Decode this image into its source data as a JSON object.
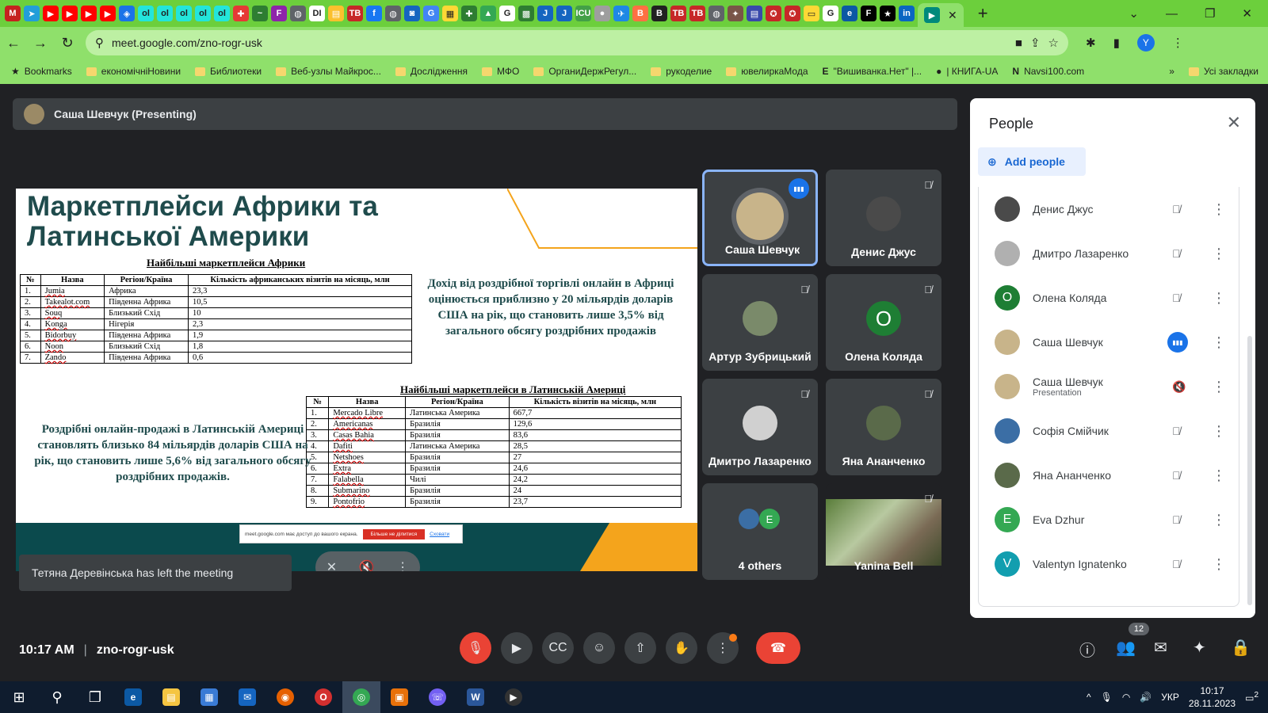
{
  "browser": {
    "favicons": [
      {
        "name": "gmail-icon",
        "color": "#c5221f",
        "glyph": "M"
      },
      {
        "name": "telegram-icon",
        "color": "#229ed9",
        "glyph": "➤"
      },
      {
        "name": "youtube-icon",
        "color": "#ff0000",
        "glyph": "▶"
      },
      {
        "name": "youtube-icon",
        "color": "#ff0000",
        "glyph": "▶"
      },
      {
        "name": "youtube-icon",
        "color": "#ff0000",
        "glyph": "▶"
      },
      {
        "name": "youtube-icon",
        "color": "#ff0000",
        "glyph": "▶"
      },
      {
        "name": "generic-site-icon",
        "color": "#1a73e8",
        "glyph": "◈"
      },
      {
        "name": "olx-icon",
        "color": "#23e5db",
        "glyph": "ol"
      },
      {
        "name": "olx-icon",
        "color": "#23e5db",
        "glyph": "ol"
      },
      {
        "name": "olx-icon",
        "color": "#23e5db",
        "glyph": "ol"
      },
      {
        "name": "olx-icon",
        "color": "#23e5db",
        "glyph": "ol"
      },
      {
        "name": "olx-icon",
        "color": "#23e5db",
        "glyph": "ol"
      },
      {
        "name": "generic-site-icon",
        "color": "#e53935",
        "glyph": "✚"
      },
      {
        "name": "generic-site-icon",
        "color": "#2e7d32",
        "glyph": "~"
      },
      {
        "name": "generic-site-icon",
        "color": "#8e24aa",
        "glyph": "F"
      },
      {
        "name": "generic-site-icon",
        "color": "#5f6368",
        "glyph": "◍"
      },
      {
        "name": "generic-site-icon",
        "color": "#ffffff",
        "glyph": "DI"
      },
      {
        "name": "generic-site-icon",
        "color": "#fbc02d",
        "glyph": "▤"
      },
      {
        "name": "tv-icon",
        "color": "#c62828",
        "glyph": "TB"
      },
      {
        "name": "facebook-icon",
        "color": "#1877f2",
        "glyph": "f"
      },
      {
        "name": "generic-site-icon",
        "color": "#5f6368",
        "glyph": "◍"
      },
      {
        "name": "generic-site-icon",
        "color": "#1565c0",
        "glyph": "◙"
      },
      {
        "name": "translate-icon",
        "color": "#4285f4",
        "glyph": "G"
      },
      {
        "name": "generic-site-icon",
        "color": "#fdd835",
        "glyph": "▦"
      },
      {
        "name": "generic-site-icon",
        "color": "#2e7d32",
        "glyph": "✚"
      },
      {
        "name": "drive-icon",
        "color": "#34a853",
        "glyph": "▲"
      },
      {
        "name": "google-icon",
        "color": "#ffffff",
        "glyph": "G"
      },
      {
        "name": "generic-site-icon",
        "color": "#2e7d32",
        "glyph": "▩"
      },
      {
        "name": "generic-site-icon",
        "color": "#1565c0",
        "glyph": "J"
      },
      {
        "name": "generic-site-icon",
        "color": "#1565c0",
        "glyph": "J"
      },
      {
        "name": "generic-site-icon",
        "color": "#43a047",
        "glyph": "ICU"
      },
      {
        "name": "generic-site-icon",
        "color": "#9e9e9e",
        "glyph": "●"
      },
      {
        "name": "generic-site-icon",
        "color": "#1e88e5",
        "glyph": "✈"
      },
      {
        "name": "generic-site-icon",
        "color": "#ff7043",
        "glyph": "B"
      },
      {
        "name": "generic-site-icon",
        "color": "#212121",
        "glyph": "B"
      },
      {
        "name": "tv-icon",
        "color": "#c62828",
        "glyph": "TB"
      },
      {
        "name": "tv-icon",
        "color": "#c62828",
        "glyph": "TB"
      },
      {
        "name": "generic-site-icon",
        "color": "#5f6368",
        "glyph": "◍"
      },
      {
        "name": "generic-site-icon",
        "color": "#795548",
        "glyph": "✦"
      },
      {
        "name": "generic-site-icon",
        "color": "#3949ab",
        "glyph": "▤"
      },
      {
        "name": "generic-site-icon",
        "color": "#c62828",
        "glyph": "✪"
      },
      {
        "name": "generic-site-icon",
        "color": "#c62828",
        "glyph": "✪"
      },
      {
        "name": "generic-site-icon",
        "color": "#fdd835",
        "glyph": "▭"
      },
      {
        "name": "google-icon",
        "color": "#ffffff",
        "glyph": "G"
      },
      {
        "name": "edge-icon",
        "color": "#0c59a4",
        "glyph": "e"
      },
      {
        "name": "generic-site-icon",
        "color": "#000000",
        "glyph": "F"
      },
      {
        "name": "generic-site-icon",
        "color": "#000000",
        "glyph": "★"
      },
      {
        "name": "linkedin-icon",
        "color": "#0a66c2",
        "glyph": "in"
      }
    ],
    "active_tab_icon": "meet-icon",
    "close_glyph": "✕",
    "new_tab_glyph": "+",
    "win_controls": [
      "⌄",
      "—",
      "❐",
      "✕"
    ],
    "url": "meet.google.com/zno-rogr-usk",
    "profile_initial": "Y",
    "bookmarks": [
      {
        "label": "Bookmarks",
        "icon": "star"
      },
      {
        "label": "економічніНовини",
        "icon": "folder"
      },
      {
        "label": "Библиотеки",
        "icon": "folder"
      },
      {
        "label": "Веб-узлы Майкрос...",
        "icon": "folder"
      },
      {
        "label": "Дослідження",
        "icon": "folder"
      },
      {
        "label": "МФО",
        "icon": "folder"
      },
      {
        "label": "ОрганиДержРегул...",
        "icon": "folder"
      },
      {
        "label": "рукоделие",
        "icon": "folder"
      },
      {
        "label": "ювелиркаМода",
        "icon": "folder"
      },
      {
        "label": "\"Вишиванка.Нет\" |...",
        "icon": "E"
      },
      {
        "label": "| КНИГА-UA",
        "icon": "dot"
      },
      {
        "label": "Navsi100.com",
        "icon": "N"
      }
    ],
    "bookmarks_more": "»",
    "all_bookmarks": "Усі закладки"
  },
  "meet": {
    "presenter_label": "Саша Шевчук (Presenting)",
    "meeting_code": "zno-rogr-usk",
    "time": "10:17 AM",
    "toast": "Тетяна Деревінська has left the meeting",
    "participants_count": "12",
    "slide": {
      "title": "Маркетплейси Африки та Латинської Америки",
      "table1_caption": "Найбільші маркетплейси Африки",
      "table1_headers": [
        "№",
        "Назва",
        "Регіон/Країна",
        "Кількість африканських візитів на місяць, млн"
      ],
      "table1_rows": [
        [
          "1.",
          "Jumia",
          "Африка",
          "23,3"
        ],
        [
          "2.",
          "Takealot.com",
          "Південна Африка",
          "10,5"
        ],
        [
          "3.",
          "Souq",
          "Близький Схід",
          "10"
        ],
        [
          "4.",
          "Konga",
          "Нігерія",
          "2,3"
        ],
        [
          "5.",
          "Bidorbuy",
          "Південна Африка",
          "1,9"
        ],
        [
          "6.",
          "Noon",
          "Близький Схід",
          "1,8"
        ],
        [
          "7.",
          "Zando",
          "Південна Африка",
          "0,6"
        ]
      ],
      "para1": "Дохід від роздрібної торгівлі онлайн в Африці оцінюється приблизно у 20 мільярдів доларів США на рік, що становить лише 3,5% від загального обсягу роздрібних продажів",
      "table2_caption": "Найбільші маркетплейси в Латинській Америці",
      "table2_headers": [
        "№",
        "Назва",
        "Регіон/Країна",
        "Кількість візитів на місяць, млн"
      ],
      "table2_rows": [
        [
          "1.",
          "Mercado Libre",
          "Латинська Америка",
          "667,7"
        ],
        [
          "2.",
          "Americanas",
          "Бразилія",
          "129,6"
        ],
        [
          "3.",
          "Casas Bahia",
          "Бразилія",
          "83,6"
        ],
        [
          "4.",
          "Dafiti",
          "Латинська Америка",
          "28,5"
        ],
        [
          "5.",
          "Netshoes",
          "Бразилія",
          "27"
        ],
        [
          "6.",
          "Extra",
          "Бразилія",
          "24,6"
        ],
        [
          "7.",
          "Falabella",
          "Чилі",
          "24,2"
        ],
        [
          "8.",
          "Submarino",
          "Бразилія",
          "24"
        ],
        [
          "9.",
          "Pontofrio",
          "Бразилія",
          "23,7"
        ]
      ],
      "para2": "Роздрібні онлайн-продажі в Латинській Америці становлять близько 84 мільярдів доларів США на рік, що становить лише 5,6% від загального обсягу роздрібних продажів.",
      "share_bar_text": "meet.google.com має доступ до вашого екрана.",
      "share_bar_stop": "Більше не ділитися",
      "share_bar_hide": "Сховати"
    },
    "tiles": [
      {
        "name": "Саша Шевчук",
        "speaking": true,
        "avatar_color": "#c8b48a",
        "initial": ""
      },
      {
        "name": "Денис Джус",
        "speaking": false,
        "avatar_color": "#4a4a4a",
        "initial": ""
      },
      {
        "name": "Артур Зубрицький",
        "speaking": false,
        "avatar_color": "#7a8a6a",
        "initial": ""
      },
      {
        "name": "Олена Коляда",
        "speaking": false,
        "avatar_color": "#1e7e34",
        "initial": "О"
      },
      {
        "name": "Дмитро Лазаренко",
        "speaking": false,
        "avatar_color": "#d0d0d0",
        "initial": ""
      },
      {
        "name": "Яна Ананченко",
        "speaking": false,
        "avatar_color": "#5a6a4a",
        "initial": ""
      }
    ],
    "others_label": "4 others",
    "others_initial": "E",
    "yb_name": "Yanina Bell",
    "people": {
      "title": "People",
      "add_label": "Add people",
      "list": [
        {
          "name": "Денис Джус",
          "sub": "",
          "color": "#4a4a4a",
          "initial": "",
          "mic": "off"
        },
        {
          "name": "Дмитро Лазаренко",
          "sub": "",
          "color": "#b0b0b0",
          "initial": "",
          "mic": "off"
        },
        {
          "name": "Олена Коляда",
          "sub": "",
          "color": "#1e7e34",
          "initial": "О",
          "mic": "off"
        },
        {
          "name": "Саша Шевчук",
          "sub": "",
          "color": "#c8b48a",
          "initial": "",
          "mic": "on"
        },
        {
          "name": "Саша Шевчук",
          "sub": "Presentation",
          "color": "#c8b48a",
          "initial": "",
          "mic": "presentation"
        },
        {
          "name": "Софія Смійчик",
          "sub": "",
          "color": "#3b6ea5",
          "initial": "",
          "mic": "off"
        },
        {
          "name": "Яна Ананченко",
          "sub": "",
          "color": "#5a6a4a",
          "initial": "",
          "mic": "off"
        },
        {
          "name": "Eva Dzhur",
          "sub": "",
          "color": "#34a853",
          "initial": "E",
          "mic": "off"
        },
        {
          "name": "Valentyn Ignatenko",
          "sub": "",
          "color": "#129eaf",
          "initial": "V",
          "mic": "off"
        }
      ]
    }
  },
  "taskbar": {
    "lang": "УКР",
    "time": "10:17",
    "date": "28.11.2023",
    "notif_count": "2"
  }
}
